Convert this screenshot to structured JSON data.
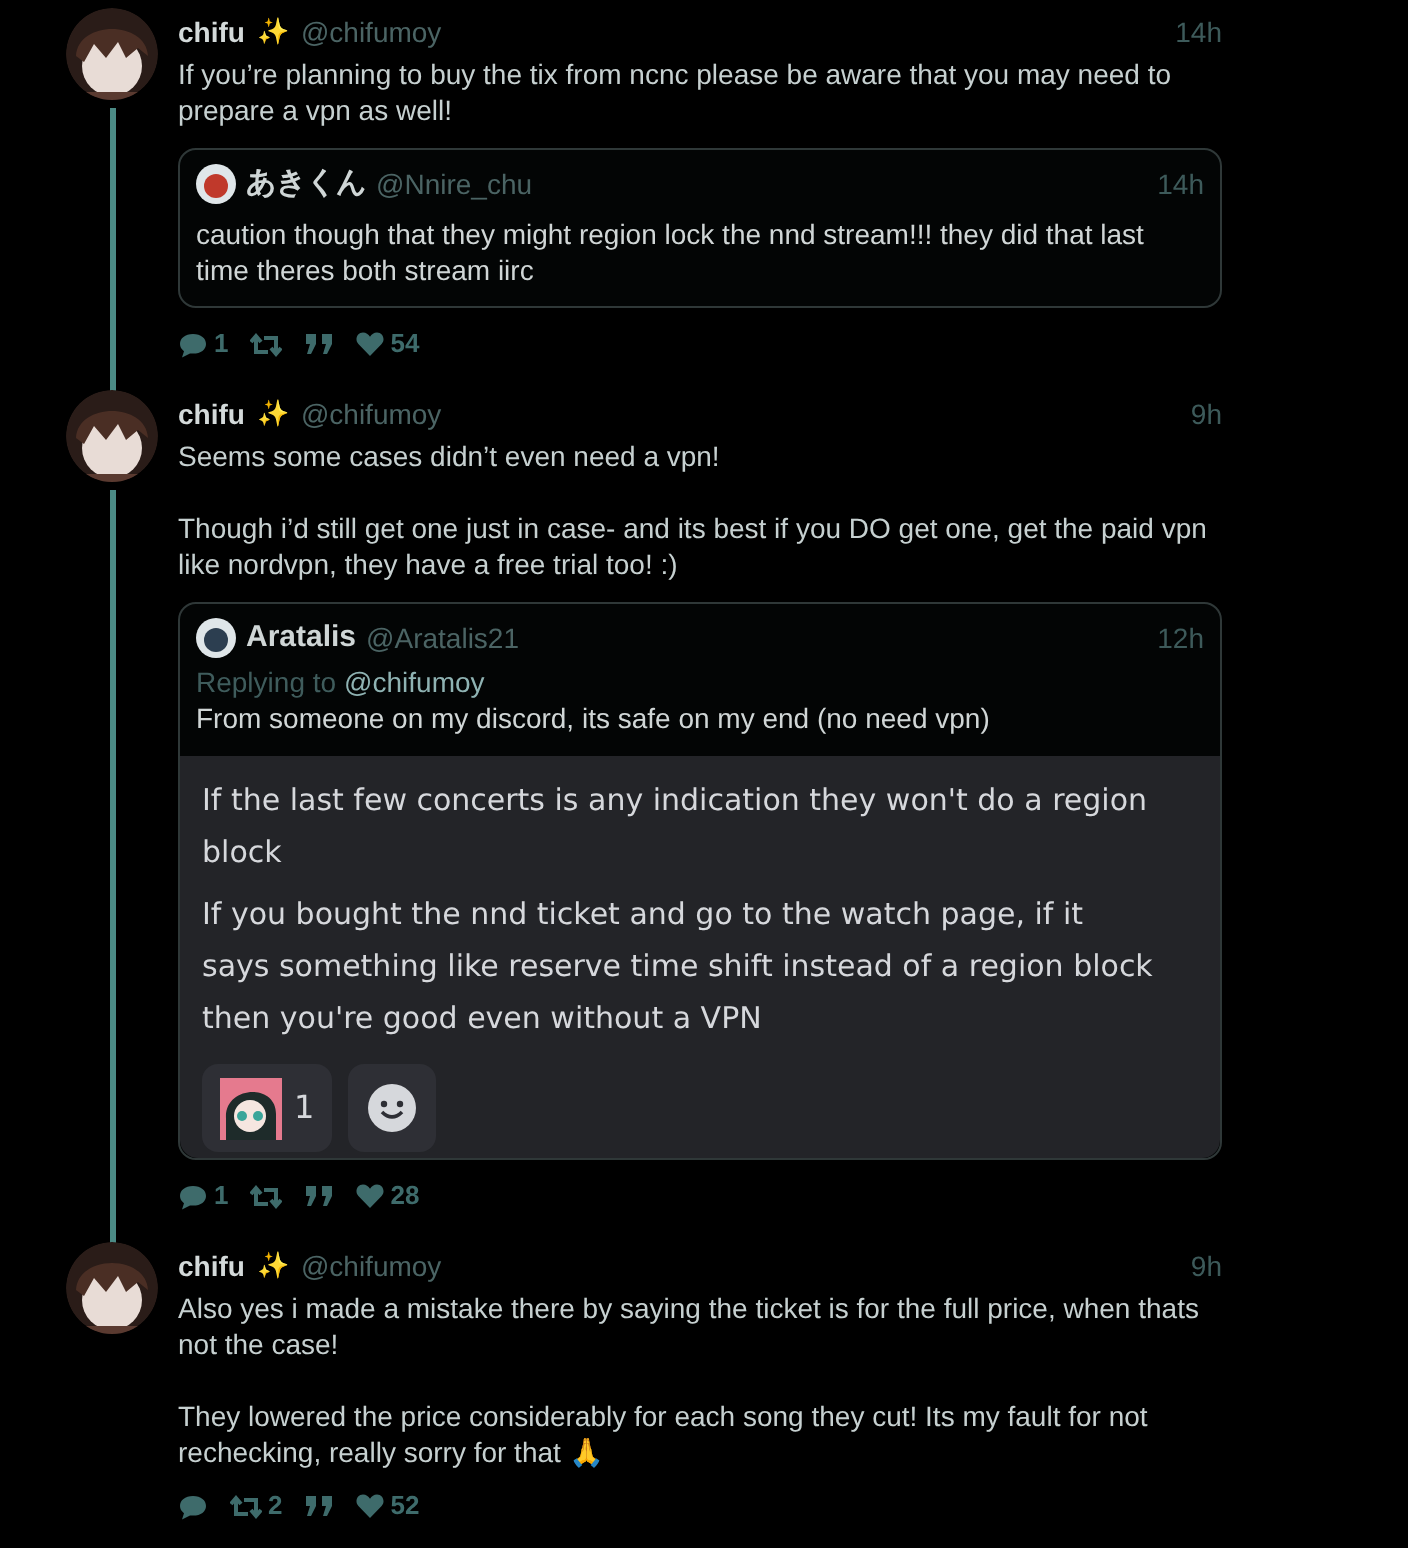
{
  "posts": [
    {
      "author": "chifu",
      "badge": "✨",
      "handle": "@chifumoy",
      "time": "14h",
      "thread_continues": true,
      "paragraphs": [
        "If you’re planning to buy the tix from ncnc please be aware that you may need to prepare a vpn as well!"
      ],
      "quote": {
        "author": "あきくん",
        "handle": "@Nnire_chu",
        "time": "14h",
        "text": "caution though that they might region lock the nnd stream!!! they did that last time theres both stream iirc"
      },
      "stats": {
        "replies": "1",
        "likes": "54"
      }
    },
    {
      "author": "chifu",
      "badge": "✨",
      "handle": "@chifumoy",
      "time": "9h",
      "thread_continues": true,
      "paragraphs": [
        "Seems some cases didn’t even need a vpn!",
        "Though i’d still get one just in case- and its best if you DO get one, get the paid vpn like nordvpn, they have a free trial too! :)"
      ],
      "quote": {
        "author": "Aratalis",
        "handle": "@Aratalis21",
        "time": "12h",
        "replying_label": "Replying to",
        "replying_to": "@chifumoy",
        "text": "From someone on my discord, its safe on my end (no need vpn)",
        "screenshot": {
          "paragraphs": [
            "If the last few concerts is any indication they won't do a region block",
            "If you bought the nnd ticket and go to the watch page, if it says something like reserve time shift instead of a region block then you're good even without a VPN"
          ],
          "reactions": [
            {
              "kind": "emoji",
              "count": "1"
            },
            {
              "kind": "add"
            }
          ]
        }
      },
      "stats": {
        "replies": "1",
        "likes": "28"
      }
    },
    {
      "author": "chifu",
      "badge": "✨",
      "handle": "@chifumoy",
      "time": "9h",
      "thread_continues": false,
      "paragraphs": [
        "Also yes i made a mistake there by saying the ticket is for the full price, when thats not the case!",
        "They lowered the price considerably for each song they cut! Its my fault for not rechecking, really sorry for that 🙏"
      ],
      "stats": {
        "retweets": "2",
        "likes": "52"
      }
    }
  ]
}
